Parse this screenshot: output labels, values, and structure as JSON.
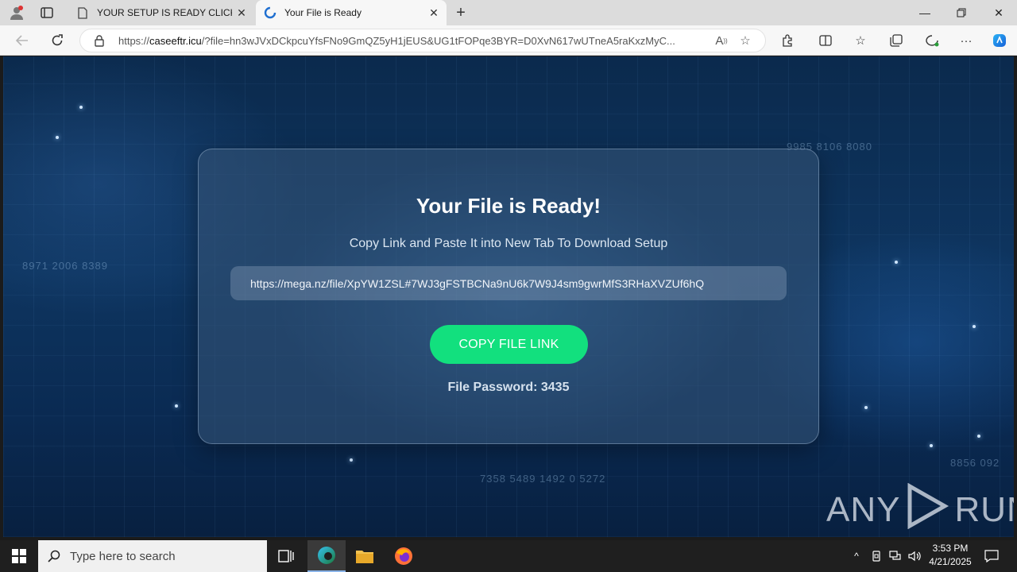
{
  "browser": {
    "tabs": [
      {
        "title": "YOUR SETUP IS READY CLICK BELOW",
        "active": false
      },
      {
        "title": "Your File is Ready",
        "active": true
      }
    ],
    "address": {
      "host": "caseeftr.icu",
      "scheme": "https://",
      "rest": "/?file=hn3wJVxDCkpcuYfsFNo9GmQZ5yH1jEUS&UG1tFOPqe3BYR=D0XvN617wUTneA5raKxzMyC..."
    }
  },
  "page": {
    "heading": "Your File is Ready!",
    "subtitle": "Copy Link and Paste It into New Tab To Download Setup",
    "file_link": "https://mega.nz/file/XpYW1ZSL#7WJ3gFSTBCNa9nU6k7W9J4sm9gwrMfS3RHaXVZUf6hQ",
    "copy_button": "COPY FILE LINK",
    "password": "File Password: 3435",
    "watermark_left": "ANY",
    "watermark_right": "RUN",
    "accent_color": "#12e07e"
  },
  "background_numbers": [
    "9985 8106 8080",
    "8971 2006 8389",
    "7358 5489 1492 0 5272",
    "8856 092"
  ],
  "taskbar": {
    "search_placeholder": "Type here to search",
    "time": "3:53 PM",
    "date": "4/21/2025"
  }
}
